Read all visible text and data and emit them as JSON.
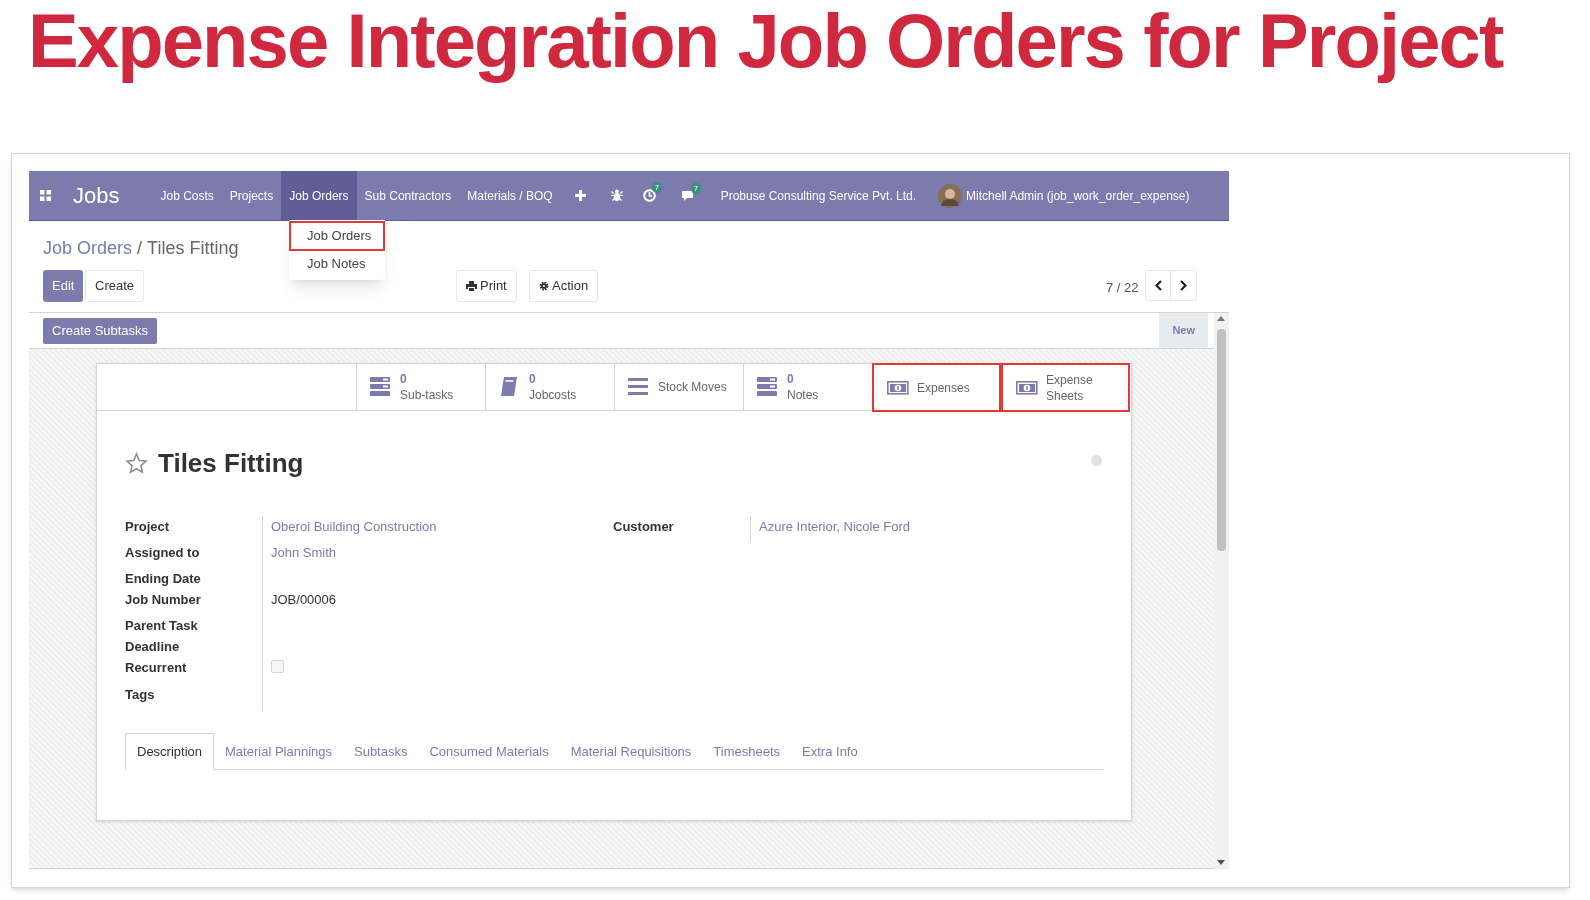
{
  "headline": "Expense Integration Job Orders for Project",
  "navbar": {
    "app": "Jobs",
    "menus": [
      {
        "label": "Job Costs",
        "selected": false
      },
      {
        "label": "Projects",
        "selected": false
      },
      {
        "label": "Job Orders",
        "selected": true
      },
      {
        "label": "Sub Contractors",
        "selected": false
      },
      {
        "label": "Materials / BOQ",
        "selected": false
      }
    ],
    "activity_count": "7",
    "message_count": "7",
    "company": "Probuse Consulting Service Pvt. Ltd.",
    "user": "Mitchell Admin (job_work_order_expense)"
  },
  "dropdown": [
    {
      "label": "Job Orders",
      "highlighted": true
    },
    {
      "label": "Job Notes",
      "highlighted": false
    }
  ],
  "breadcrumb": {
    "parent": "Job Orders",
    "separator": "/",
    "current": "Tiles Fitting"
  },
  "buttons": {
    "edit": "Edit",
    "create": "Create",
    "print": "Print",
    "action": "Action",
    "create_subtasks": "Create Subtasks",
    "status": "New"
  },
  "pager": "7 / 22",
  "smart_buttons": [
    {
      "kind": "stack",
      "count": "0",
      "label": "Sub-tasks",
      "highlighted": false
    },
    {
      "kind": "book",
      "count": "0",
      "label": "Jobcosts",
      "highlighted": false
    },
    {
      "kind": "list",
      "label": "Stock Moves",
      "highlighted": false
    },
    {
      "kind": "stack",
      "count": "0",
      "label": "Notes",
      "highlighted": false
    },
    {
      "kind": "money",
      "label": "Expenses",
      "highlighted": true
    },
    {
      "kind": "money",
      "label": "Expense Sheets",
      "highlighted": true
    }
  ],
  "record": {
    "title": "Tiles Fitting",
    "starred": false
  },
  "fields": [
    {
      "label": "Project",
      "kind": "link",
      "value": "Oberoi Building Construction"
    },
    {
      "label": "Assigned to",
      "kind": "link",
      "value": "John Smith"
    },
    {
      "label": "Ending Date",
      "kind": "empty"
    },
    {
      "label": "Job Number",
      "kind": "text",
      "value": "JOB/00006"
    },
    {
      "label": "Parent Task",
      "kind": "empty"
    },
    {
      "label": "Deadline",
      "kind": "empty"
    },
    {
      "label": "Recurrent",
      "kind": "checkbox",
      "checked": false
    },
    {
      "label": "Tags",
      "kind": "empty"
    }
  ],
  "right_fields": [
    {
      "label": "Customer",
      "kind": "link",
      "value": "Azure Interior, Nicole Ford"
    }
  ],
  "tabs": [
    {
      "label": "Description",
      "selected": true
    },
    {
      "label": "Material Plannings",
      "selected": false
    },
    {
      "label": "Subtasks",
      "selected": false
    },
    {
      "label": "Consumed Materials",
      "selected": false
    },
    {
      "label": "Material Requisitions",
      "selected": false
    },
    {
      "label": "Timesheets",
      "selected": false
    },
    {
      "label": "Extra Info",
      "selected": false
    }
  ]
}
